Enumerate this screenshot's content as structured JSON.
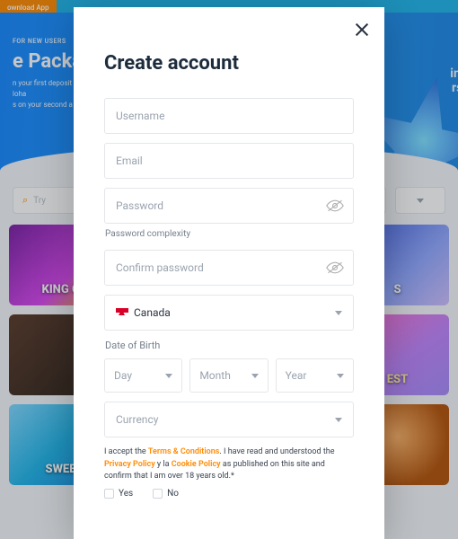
{
  "topbar": {
    "download_label": "ownload App"
  },
  "banner": {
    "tag": "FOR NEW USERS",
    "title": "e Packa",
    "sub_line1": "n your first deposit",
    "sub_line2": "loha",
    "sub_line3": "s on your second a",
    "right_line1": "ins",
    "right_line2": "rst"
  },
  "search": {
    "placeholder": "Try"
  },
  "tiles": {
    "t1": "KING C",
    "t4": "S",
    "t5": "SWEE",
    "t6": "EST"
  },
  "modal": {
    "title": "Create account",
    "username_ph": "Username",
    "email_ph": "Email",
    "password_ph": "Password",
    "complexity": "Password complexity",
    "confirm_ph": "Confirm password",
    "country": "Canada",
    "dob_label": "Date of Birth",
    "day": "Day",
    "month": "Month",
    "year": "Year",
    "currency": "Currency",
    "terms_pre": "I accept the ",
    "terms_link": "Terms & Conditions",
    "terms_mid": ". I have read and understood the ",
    "privacy_link": "Privacy Policy",
    "terms_mid2": " y la ",
    "cookie_link": "Cookie Policy",
    "terms_post": " as published on this site and confirm that I am over 18 years old.*",
    "yes": "Yes",
    "no": "No"
  }
}
